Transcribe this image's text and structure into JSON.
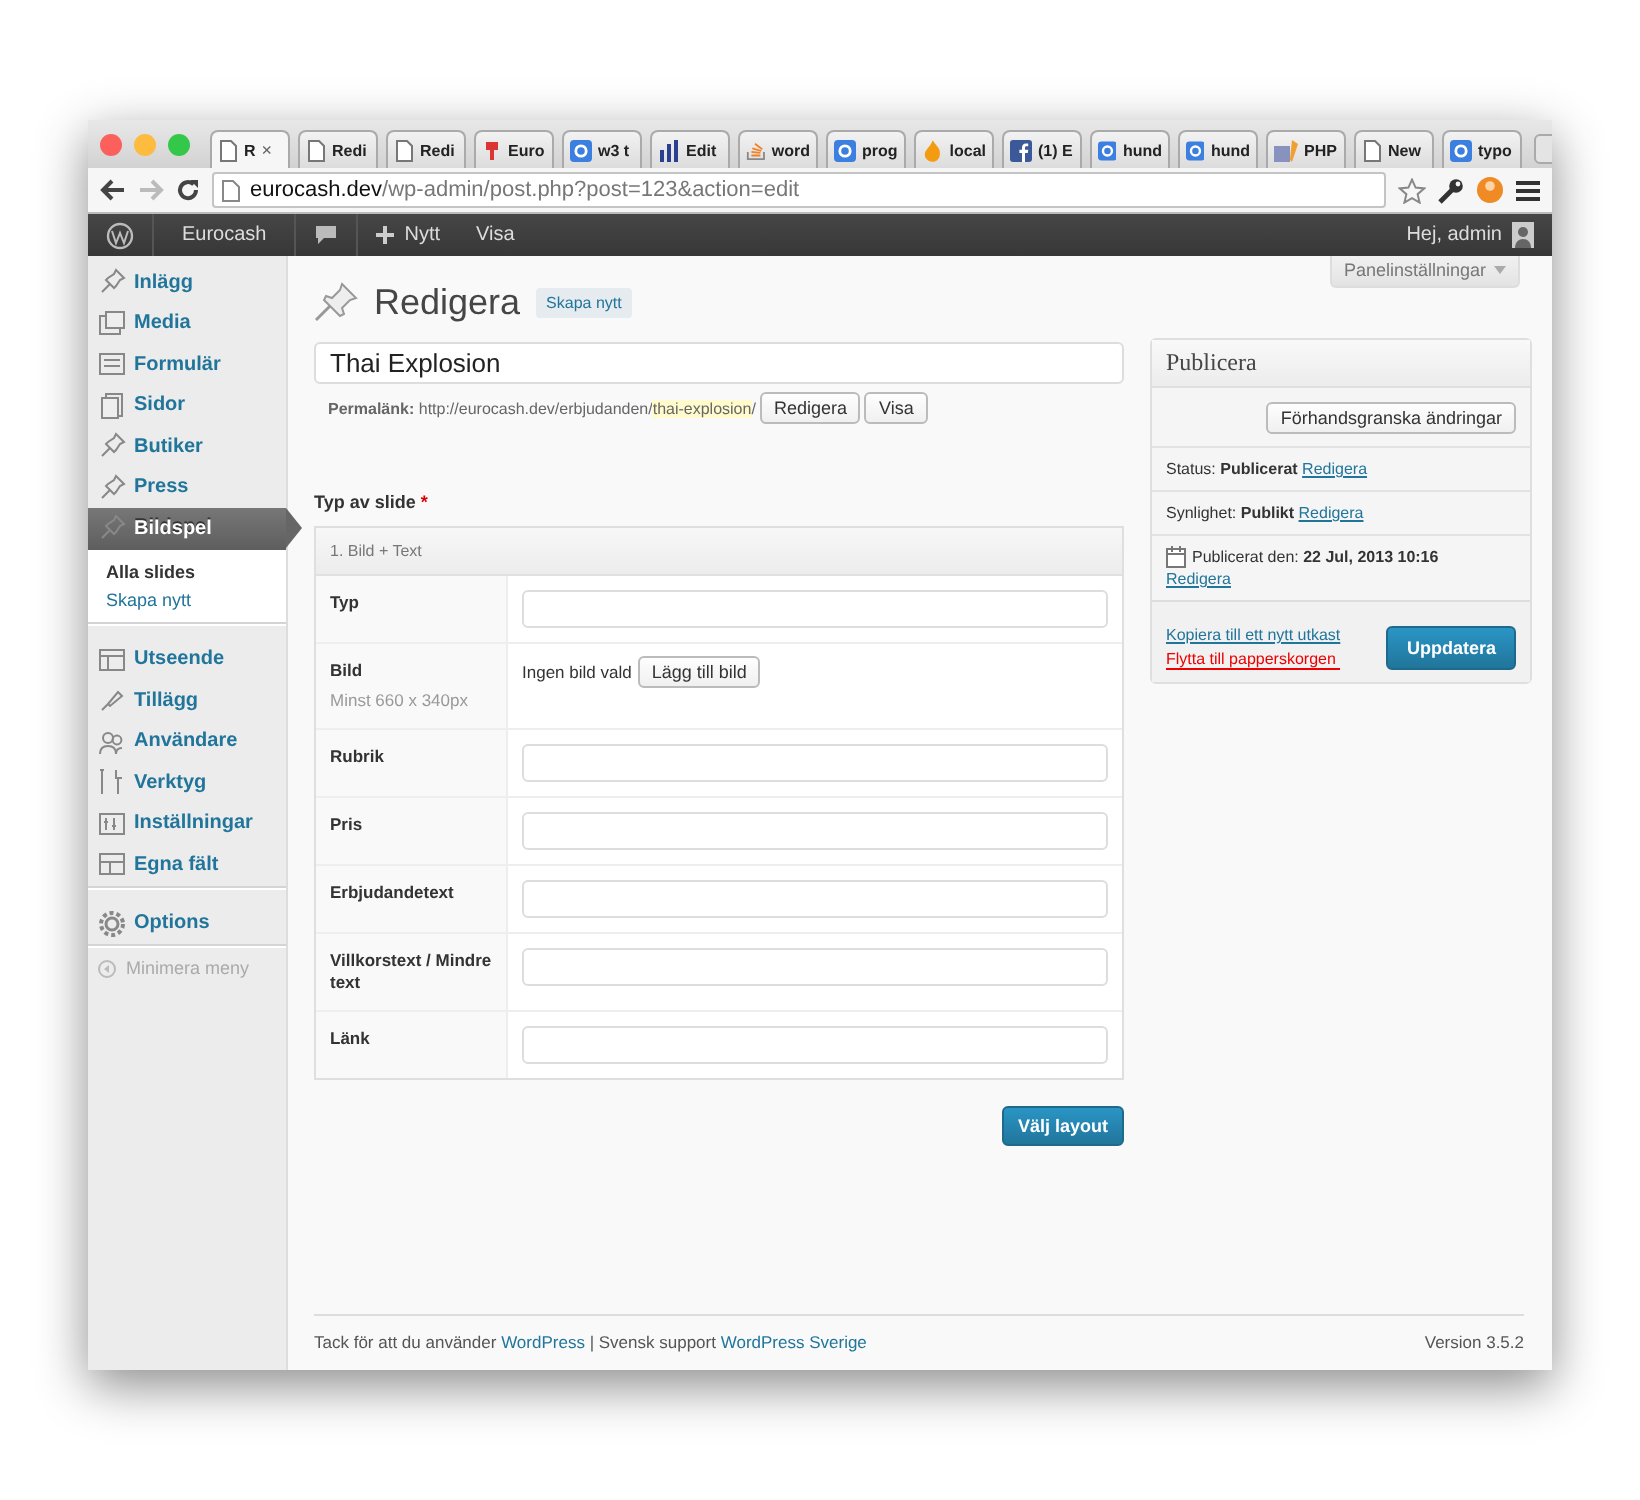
{
  "browser": {
    "tabs": [
      {
        "title": "R",
        "kind": "page",
        "selected": true,
        "close": "×"
      },
      {
        "title": "Redi",
        "kind": "page",
        "selected": false
      },
      {
        "title": "Redi",
        "kind": "page",
        "selected": false
      },
      {
        "title": "Euro",
        "kind": "pin",
        "selected": false
      },
      {
        "title": "w3 t",
        "kind": "google",
        "selected": false
      },
      {
        "title": "Edit",
        "kind": "chart",
        "selected": false
      },
      {
        "title": "word",
        "kind": "stack",
        "selected": false
      },
      {
        "title": "prog",
        "kind": "google",
        "selected": false
      },
      {
        "title": "local",
        "kind": "flame",
        "selected": false
      },
      {
        "title": "(1) E",
        "kind": "facebook",
        "selected": false
      },
      {
        "title": "hund",
        "kind": "google",
        "selected": false
      },
      {
        "title": "hund",
        "kind": "google",
        "selected": false
      },
      {
        "title": "PHP",
        "kind": "php",
        "selected": false
      },
      {
        "title": "New",
        "kind": "page",
        "selected": false
      },
      {
        "title": "typo",
        "kind": "google",
        "selected": false
      }
    ],
    "url": {
      "host": "eurocash.dev",
      "path": "/wp-admin/post.php?post=123&action=edit"
    }
  },
  "admin_bar": {
    "site": "Eurocash",
    "new": "Nytt",
    "view": "Visa",
    "greeting": "Hej, admin"
  },
  "sidebar": {
    "groups": [
      [
        {
          "label": "Inlägg",
          "kind": "pin",
          "selected": false
        },
        {
          "label": "Media",
          "kind": "media",
          "selected": false
        },
        {
          "label": "Formulär",
          "kind": "form",
          "selected": false
        },
        {
          "label": "Sidor",
          "kind": "pages",
          "selected": false
        },
        {
          "label": "Butiker",
          "kind": "pin",
          "selected": false
        },
        {
          "label": "Press",
          "kind": "pin",
          "selected": false
        },
        {
          "label": "Bildspel",
          "kind": "pin",
          "selected": true,
          "submenu": [
            {
              "label": "Alla slides",
              "selected": true
            },
            {
              "label": "Skapa nytt",
              "selected": false
            }
          ]
        }
      ],
      [
        {
          "label": "Utseende",
          "kind": "appearance",
          "selected": false
        },
        {
          "label": "Tillägg",
          "kind": "plugin",
          "selected": false
        },
        {
          "label": "Användare",
          "kind": "users",
          "selected": false
        },
        {
          "label": "Verktyg",
          "kind": "tools",
          "selected": false
        },
        {
          "label": "Inställningar",
          "kind": "settings",
          "selected": false
        },
        {
          "label": "Egna fält",
          "kind": "fields",
          "selected": false
        }
      ],
      [
        {
          "label": "Options",
          "kind": "gear",
          "selected": false
        }
      ]
    ],
    "collapse": "Minimera meny"
  },
  "screen_options": "Panelinställningar",
  "editor": {
    "heading": "Redigera",
    "add_new": "Skapa nytt",
    "title": "Thai Explosion",
    "permalink": {
      "label": "Permalänk:",
      "base": "http://eurocash.dev/erbjudanden/",
      "slug": "thai-explosion",
      "suffix": "/",
      "edit": "Redigera",
      "view": "Visa"
    },
    "field_group": {
      "label": "Typ av slide",
      "required": "*",
      "layout_title": "1. Bild + Text",
      "fields": [
        {
          "kind": "text",
          "label": "Typ"
        },
        {
          "kind": "image",
          "label": "Bild",
          "hint": "Minst 660 x 340px",
          "status": "Ingen bild vald",
          "button": "Lägg till bild"
        },
        {
          "kind": "text",
          "label": "Rubrik"
        },
        {
          "kind": "text",
          "label": "Pris"
        },
        {
          "kind": "text",
          "label": "Erbjudandetext"
        },
        {
          "kind": "text",
          "label": "Villkorstext / Mindre text"
        },
        {
          "kind": "text",
          "label": "Länk"
        }
      ],
      "button": "Välj layout"
    }
  },
  "publish": {
    "title": "Publicera",
    "preview": "Förhandsgranska ändringar",
    "rows": [
      {
        "kind": "status",
        "text": "Status: **Publicerat**",
        "link": "Redigera"
      },
      {
        "kind": "visibility",
        "text": "Synlighet: **Publikt**",
        "link": "Redigera"
      },
      {
        "kind": "date",
        "text": "Publicerat den: **22 Jul, 2013 10:16**",
        "link": "Redigera"
      }
    ],
    "copy": "Kopiera till ett nytt utkast",
    "trash": "Flytta till papperskorgen",
    "update": "Uppdatera"
  },
  "footer": {
    "text": "Tack för att du använder",
    "link1": "WordPress",
    "separator": "|",
    "text2": "Svensk support",
    "link2": "WordPress Sverige",
    "version": "Version 3.5.2"
  }
}
